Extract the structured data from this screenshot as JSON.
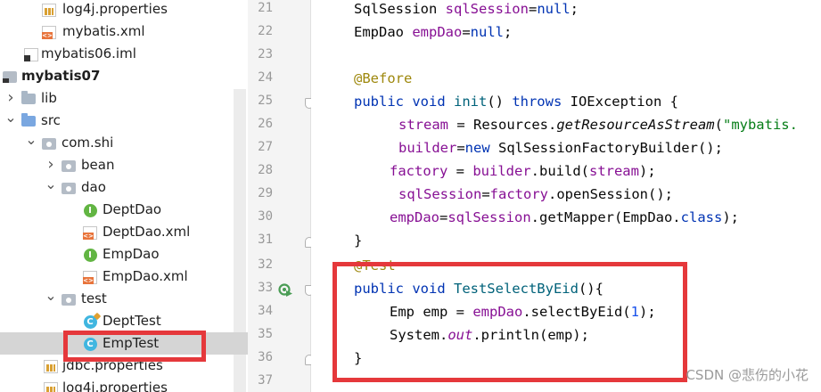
{
  "tree": {
    "items": [
      {
        "label": "log4j.properties",
        "icon": "properties-file-icon"
      },
      {
        "label": "mybatis.xml",
        "icon": "xml-file-icon"
      },
      {
        "label": "mybatis06.iml",
        "icon": "iml-file-icon"
      },
      {
        "label": "mybatis07",
        "icon": "module-icon"
      },
      {
        "label": "lib",
        "icon": "folder-icon"
      },
      {
        "label": "src",
        "icon": "source-folder-icon"
      },
      {
        "label": "com.shi",
        "icon": "package-icon"
      },
      {
        "label": "bean",
        "icon": "package-icon"
      },
      {
        "label": "dao",
        "icon": "package-icon"
      },
      {
        "label": "DeptDao",
        "icon": "interface-icon"
      },
      {
        "label": "DeptDao.xml",
        "icon": "xml-file-icon"
      },
      {
        "label": "EmpDao",
        "icon": "interface-icon"
      },
      {
        "label": "EmpDao.xml",
        "icon": "xml-file-icon"
      },
      {
        "label": "test",
        "icon": "package-icon"
      },
      {
        "label": "DeptTest",
        "icon": "test-class-icon"
      },
      {
        "label": "EmpTest",
        "icon": "class-icon"
      },
      {
        "label": "jdbc.properties",
        "icon": "properties-file-icon"
      },
      {
        "label": "log4j.properties",
        "icon": "properties-file-icon"
      }
    ],
    "icon_glyphs": {
      "interface": "I",
      "class": "C"
    }
  },
  "editor": {
    "line_numbers": [
      "21",
      "22",
      "23",
      "24",
      "25",
      "26",
      "27",
      "28",
      "29",
      "30",
      "31",
      "32",
      "33",
      "34",
      "35",
      "36",
      "37"
    ],
    "lines": [
      [
        {
          "t": "SqlSession "
        },
        {
          "t": "sqlSession",
          "c": "fld"
        },
        {
          "t": "="
        },
        {
          "t": "null",
          "c": "kw"
        },
        {
          "t": ";"
        }
      ],
      [
        {
          "t": "EmpDao "
        },
        {
          "t": "empDao",
          "c": "fld"
        },
        {
          "t": "="
        },
        {
          "t": "null",
          "c": "kw"
        },
        {
          "t": ";"
        }
      ],
      [],
      [
        {
          "t": "@Before",
          "c": "ann"
        }
      ],
      [
        {
          "t": "public void ",
          "c": "kw"
        },
        {
          "t": "init",
          "c": "mth"
        },
        {
          "t": "() "
        },
        {
          "t": "throws ",
          "c": "kw"
        },
        {
          "t": "IOException {"
        }
      ],
      [
        {
          "t": "stream",
          "c": "fld"
        },
        {
          "t": " = Resources."
        },
        {
          "t": "getResourceAsStream",
          "c": "it"
        },
        {
          "t": "("
        },
        {
          "t": "\"mybatis.",
          "c": "str"
        }
      ],
      [
        {
          "t": "builder",
          "c": "fld"
        },
        {
          "t": "="
        },
        {
          "t": "new ",
          "c": "kw"
        },
        {
          "t": "SqlSessionFactoryBuilder();"
        }
      ],
      [
        {
          "t": "factory",
          "c": "fld"
        },
        {
          "t": " = "
        },
        {
          "t": "builder",
          "c": "fld"
        },
        {
          "t": ".build("
        },
        {
          "t": "stream",
          "c": "fld"
        },
        {
          "t": ");"
        }
      ],
      [
        {
          "t": "sqlSession",
          "c": "fld"
        },
        {
          "t": "="
        },
        {
          "t": "factory",
          "c": "fld"
        },
        {
          "t": ".openSession();"
        }
      ],
      [
        {
          "t": "empDao",
          "c": "fld"
        },
        {
          "t": "="
        },
        {
          "t": "sqlSession",
          "c": "fld"
        },
        {
          "t": ".getMapper(EmpDao."
        },
        {
          "t": "class",
          "c": "kw"
        },
        {
          "t": ");"
        }
      ],
      [
        {
          "t": "}"
        }
      ],
      [
        {
          "t": "@Test",
          "c": "ann"
        }
      ],
      [
        {
          "t": "public void ",
          "c": "kw"
        },
        {
          "t": "TestSelectByEid",
          "c": "mth"
        },
        {
          "t": "(){"
        }
      ],
      [
        {
          "t": "Emp emp = "
        },
        {
          "t": "empDao",
          "c": "fld"
        },
        {
          "t": ".selectByEid("
        },
        {
          "t": "1",
          "c": "num"
        },
        {
          "t": ");"
        }
      ],
      [
        {
          "t": "System."
        },
        {
          "t": "out",
          "c": "fld it"
        },
        {
          "t": ".println(emp);"
        }
      ],
      [
        {
          "t": "}"
        }
      ],
      []
    ]
  },
  "watermark": "CSDN @悲伤的小花",
  "colors": {
    "highlight": "#e5383b",
    "selection": "#d5d5d5"
  }
}
